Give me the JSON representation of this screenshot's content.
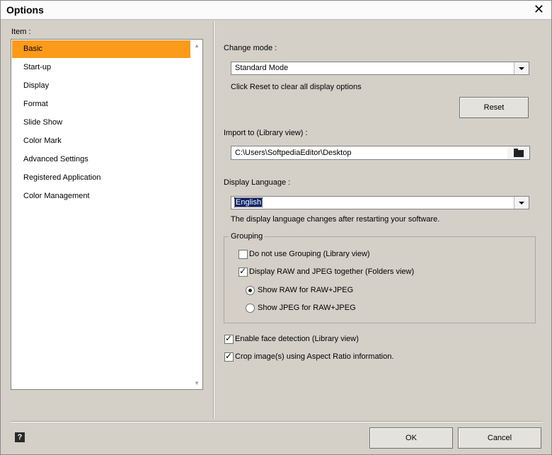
{
  "window": {
    "title": "Options"
  },
  "sidebar": {
    "label": "Item :",
    "items": [
      {
        "label": "Basic",
        "selected": true
      },
      {
        "label": "Start-up"
      },
      {
        "label": "Display"
      },
      {
        "label": "Format"
      },
      {
        "label": "Slide Show"
      },
      {
        "label": "Color Mark"
      },
      {
        "label": "Advanced Settings"
      },
      {
        "label": "Registered Application"
      },
      {
        "label": "Color Management"
      }
    ]
  },
  "basic": {
    "change_mode_label": "Change mode :",
    "change_mode_value": "Standard Mode",
    "reset_hint": "Click Reset to clear all display options",
    "reset_button": "Reset",
    "import_label": "Import to (Library view) :",
    "import_path": "C:\\Users\\SoftpediaEditor\\Desktop",
    "language_label": "Display Language :",
    "language_value": "English",
    "language_hint": "The display language changes after restarting your software.",
    "grouping": {
      "title": "Grouping",
      "no_grouping": {
        "label": "Do not use Grouping (Library view)",
        "checked": false
      },
      "raw_jpeg_together": {
        "label": "Display RAW and JPEG together (Folders view)",
        "checked": true
      },
      "show_raw": {
        "label": "Show RAW for RAW+JPEG",
        "selected": true
      },
      "show_jpeg": {
        "label": "Show JPEG for RAW+JPEG",
        "selected": false
      }
    },
    "face_detection": {
      "label": "Enable face detection (Library view)",
      "checked": true
    },
    "crop_aspect": {
      "label": "Crop image(s) using Aspect Ratio information.",
      "checked": true
    }
  },
  "footer": {
    "help_glyph": "?",
    "ok_button": "OK",
    "cancel_button": "Cancel"
  },
  "colors": {
    "selection": "#fc9a1a",
    "background": "#d4d0c8"
  }
}
